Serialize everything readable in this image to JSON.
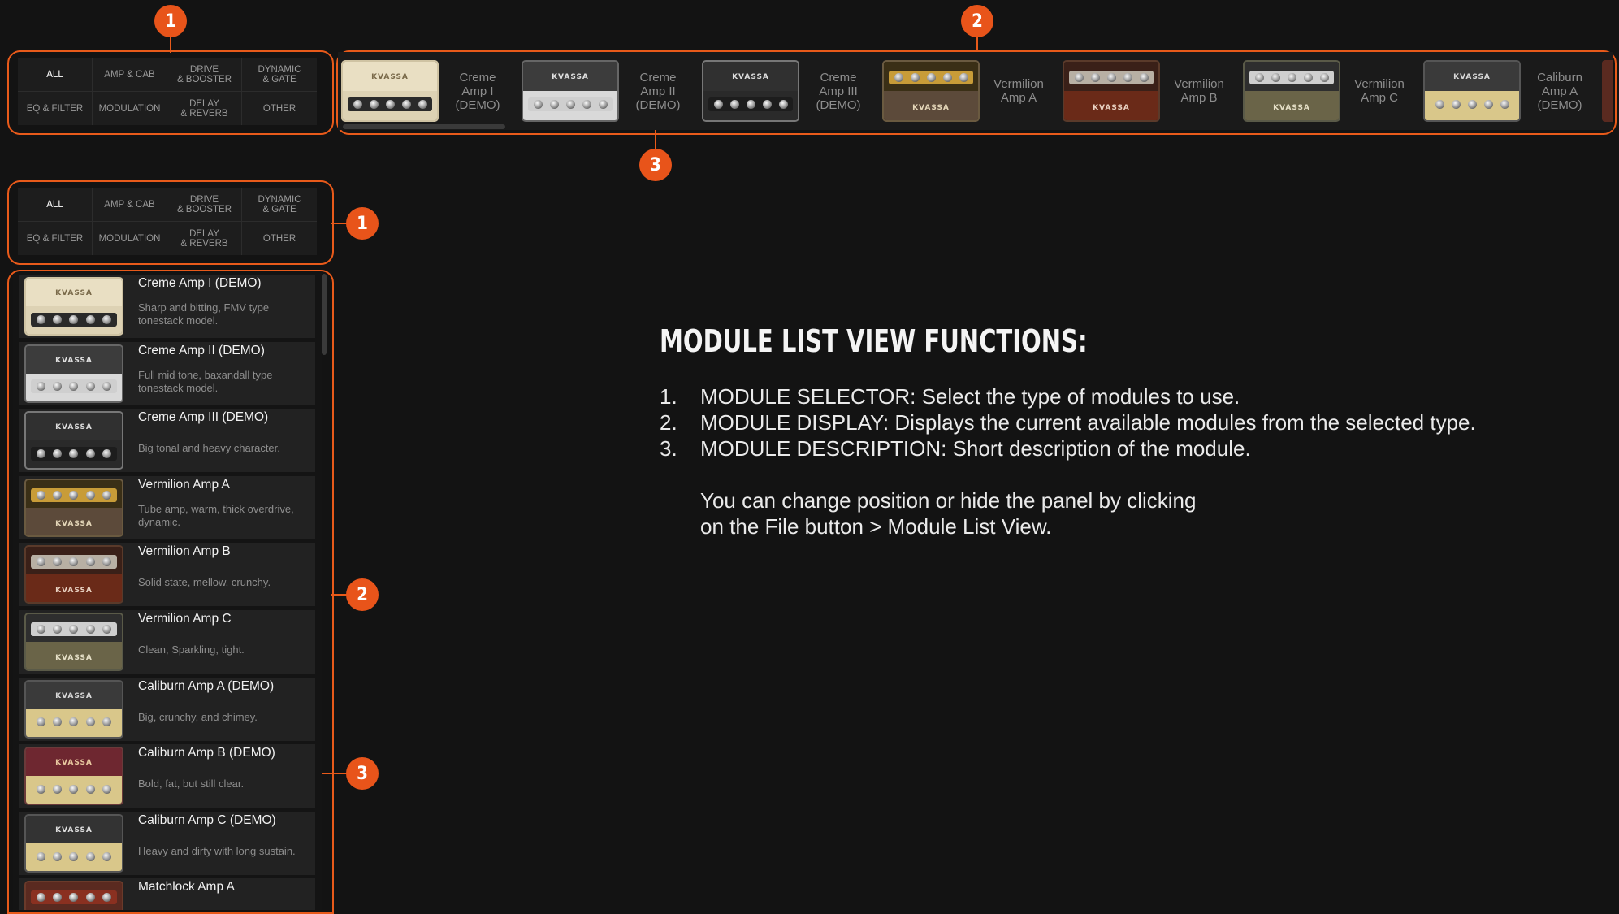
{
  "callouts": {
    "one": "1",
    "two": "2",
    "three": "3"
  },
  "selector": {
    "cells": [
      {
        "label": "ALL",
        "active": true
      },
      {
        "label": "AMP & CAB",
        "active": false
      },
      {
        "label": "DRIVE\n& BOOSTER",
        "active": false
      },
      {
        "label": "DYNAMIC\n& GATE",
        "active": false
      },
      {
        "label": "EQ & FILTER",
        "active": false
      },
      {
        "label": "MODULATION",
        "active": false
      },
      {
        "label": "DELAY\n& REVERB",
        "active": false
      },
      {
        "label": "OTHER",
        "active": false
      }
    ]
  },
  "strip": {
    "items": [
      {
        "name": "Creme\nAmp I\n(DEMO)",
        "style": "creme"
      },
      {
        "name": "Creme\nAmp II\n(DEMO)",
        "style": "silver"
      },
      {
        "name": "Creme\nAmp III\n(DEMO)",
        "style": "dark"
      },
      {
        "name": "Vermilion\nAmp A",
        "style": "vermA"
      },
      {
        "name": "Vermilion\nAmp B",
        "style": "vermB"
      },
      {
        "name": "Vermilion\nAmp C",
        "style": "vermC"
      },
      {
        "name": "Caliburn\nAmp A\n(DEMO)",
        "style": "calA"
      }
    ]
  },
  "list": {
    "items": [
      {
        "title": "Creme Amp I (DEMO)",
        "desc": "Sharp and bitting, FMV type tonestack model.",
        "style": "creme"
      },
      {
        "title": "Creme Amp II (DEMO)",
        "desc": "Full mid tone, baxandall type tonestack model.",
        "style": "silver"
      },
      {
        "title": "Creme Amp III (DEMO)",
        "desc": "Big tonal and heavy character.",
        "style": "dark"
      },
      {
        "title": "Vermilion Amp A",
        "desc": "Tube amp, warm, thick overdrive, dynamic.",
        "style": "vermA"
      },
      {
        "title": "Vermilion Amp B",
        "desc": "Solid state, mellow, crunchy.",
        "style": "vermB"
      },
      {
        "title": "Vermilion Amp C",
        "desc": "Clean, Sparkling, tight.",
        "style": "vermC"
      },
      {
        "title": "Caliburn Amp A (DEMO)",
        "desc": "Big, crunchy, and chimey.",
        "style": "calA"
      },
      {
        "title": "Caliburn Amp B (DEMO)",
        "desc": "Bold, fat, but still clear.",
        "style": "calB"
      },
      {
        "title": "Caliburn Amp C (DEMO)",
        "desc": "Heavy and dirty with long sustain.",
        "style": "calC"
      },
      {
        "title": "Matchlock Amp A",
        "desc": "",
        "style": "match"
      }
    ]
  },
  "info": {
    "heading": "MODULE LIST VIEW FUNCTIONS:",
    "functions": [
      {
        "num": "1.",
        "text": "MODULE SELECTOR: Select the type of modules to use."
      },
      {
        "num": "2.",
        "text": "MODULE DISPLAY: Displays the current available modules from the selected type."
      },
      {
        "num": "3.",
        "text": "MODULE DESCRIPTION: Short description of the module."
      }
    ],
    "note_line1": "You can change position or hide the panel by clicking",
    "note_line2": "on the File button > Module List View."
  },
  "brand_logo": "KVASSA",
  "colors": {
    "accent": "#e8541a",
    "background": "#131313"
  }
}
